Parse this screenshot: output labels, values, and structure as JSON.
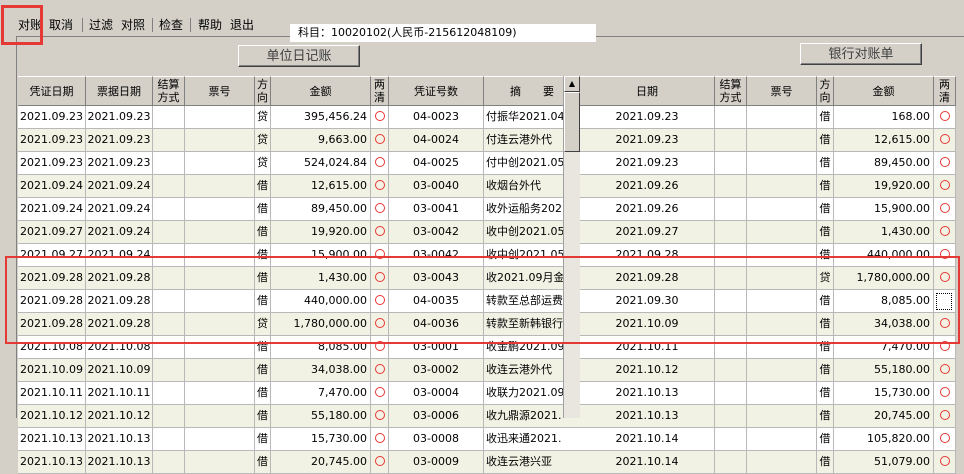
{
  "menu": {
    "items": [
      {
        "id": "reconcile",
        "label": "对账"
      },
      {
        "id": "cancel",
        "label": "取消"
      },
      {
        "id": "filter",
        "label": "过滤"
      },
      {
        "id": "compare",
        "label": "对照"
      },
      {
        "id": "check",
        "label": "检查"
      },
      {
        "id": "help",
        "label": "帮助"
      },
      {
        "id": "exit",
        "label": "退出"
      }
    ]
  },
  "subject": "科目：10020102(人民币-215612048109)",
  "left_panel": {
    "title": "单位日记账",
    "headers": [
      "凭证日期",
      "票据日期",
      "结算方式",
      "票号",
      "方向",
      "金额",
      "两清",
      "凭证号数",
      "摘　　要"
    ],
    "rows": [
      [
        "2021.09.23",
        "2021.09.23",
        "",
        "",
        "贷",
        "395,456.24",
        "○",
        "04-0023",
        "付振华2021.04"
      ],
      [
        "2021.09.23",
        "2021.09.23",
        "",
        "",
        "贷",
        "9,663.00",
        "○",
        "04-0024",
        "付连云港外代"
      ],
      [
        "2021.09.23",
        "2021.09.23",
        "",
        "",
        "贷",
        "524,024.84",
        "○",
        "04-0025",
        "付中创2021.05"
      ],
      [
        "2021.09.24",
        "2021.09.24",
        "",
        "",
        "借",
        "12,615.00",
        "○",
        "03-0040",
        "收烟台外代"
      ],
      [
        "2021.09.24",
        "2021.09.24",
        "",
        "",
        "借",
        "89,450.00",
        "○",
        "03-0041",
        "收外运船务202"
      ],
      [
        "2021.09.27",
        "2021.09.24",
        "",
        "",
        "借",
        "19,920.00",
        "○",
        "03-0042",
        "收中创2021.05"
      ],
      [
        "2021.09.27",
        "2021.09.24",
        "",
        "",
        "借",
        "15,900.00",
        "○",
        "03-0042",
        "收中创2021.05"
      ],
      [
        "2021.09.28",
        "2021.09.28",
        "",
        "",
        "借",
        "1,430.00",
        "○",
        "03-0043",
        "收2021.09月金"
      ],
      [
        "2021.09.28",
        "2021.09.28",
        "",
        "",
        "借",
        "440,000.00",
        "○",
        "04-0035",
        "转款至总部运费"
      ],
      [
        "2021.09.28",
        "2021.09.28",
        "",
        "",
        "贷",
        "1,780,000.00",
        "○",
        "04-0036",
        "转款至新韩银行"
      ],
      [
        "2021.10.08",
        "2021.10.08",
        "",
        "",
        "借",
        "8,085.00",
        "○",
        "03-0001",
        "收金鹏2021.09"
      ],
      [
        "2021.10.09",
        "2021.10.09",
        "",
        "",
        "借",
        "34,038.00",
        "○",
        "03-0002",
        "收连云港外代"
      ],
      [
        "2021.10.11",
        "2021.10.11",
        "",
        "",
        "借",
        "7,470.00",
        "○",
        "03-0004",
        "收联力2021.09"
      ],
      [
        "2021.10.12",
        "2021.10.12",
        "",
        "",
        "借",
        "55,180.00",
        "○",
        "03-0006",
        "收九鼎源2021."
      ],
      [
        "2021.10.13",
        "2021.10.13",
        "",
        "",
        "借",
        "15,730.00",
        "○",
        "03-0008",
        "收迅来通2021."
      ],
      [
        "2021.10.13",
        "2021.10.13",
        "",
        "",
        "借",
        "20,745.00",
        "○",
        "03-0009",
        "收连云港兴亚"
      ]
    ]
  },
  "right_panel": {
    "title": "银行对账单",
    "headers": [
      "日期",
      "结算方式",
      "票号",
      "方向",
      "金额",
      "两清"
    ],
    "rows": [
      [
        "2021.09.23",
        "",
        "",
        "借",
        "168.00",
        "○"
      ],
      [
        "2021.09.23",
        "",
        "",
        "借",
        "12,615.00",
        "○"
      ],
      [
        "2021.09.23",
        "",
        "",
        "借",
        "89,450.00",
        "○"
      ],
      [
        "2021.09.26",
        "",
        "",
        "借",
        "19,920.00",
        "○"
      ],
      [
        "2021.09.26",
        "",
        "",
        "借",
        "15,900.00",
        "○"
      ],
      [
        "2021.09.27",
        "",
        "",
        "借",
        "1,430.00",
        "○"
      ],
      [
        "2021.09.28",
        "",
        "",
        "借",
        "440,000.00",
        "○"
      ],
      [
        "2021.09.28",
        "",
        "",
        "贷",
        "1,780,000.00",
        "○"
      ],
      [
        "2021.09.30",
        "",
        "",
        "借",
        "8,085.00",
        ""
      ],
      [
        "2021.10.09",
        "",
        "",
        "借",
        "34,038.00",
        "○"
      ],
      [
        "2021.10.11",
        "",
        "",
        "借",
        "7,470.00",
        "○"
      ],
      [
        "2021.10.12",
        "",
        "",
        "借",
        "55,180.00",
        "○"
      ],
      [
        "2021.10.13",
        "",
        "",
        "借",
        "15,730.00",
        "○"
      ],
      [
        "2021.10.13",
        "",
        "",
        "借",
        "20,745.00",
        "○"
      ],
      [
        "2021.10.14",
        "",
        "",
        "借",
        "105,820.00",
        "○"
      ],
      [
        "2021.10.14",
        "",
        "",
        "借",
        "51,079.00",
        "○"
      ]
    ]
  },
  "colors": {
    "highlight": "#e53935",
    "circle": "#e53935"
  }
}
